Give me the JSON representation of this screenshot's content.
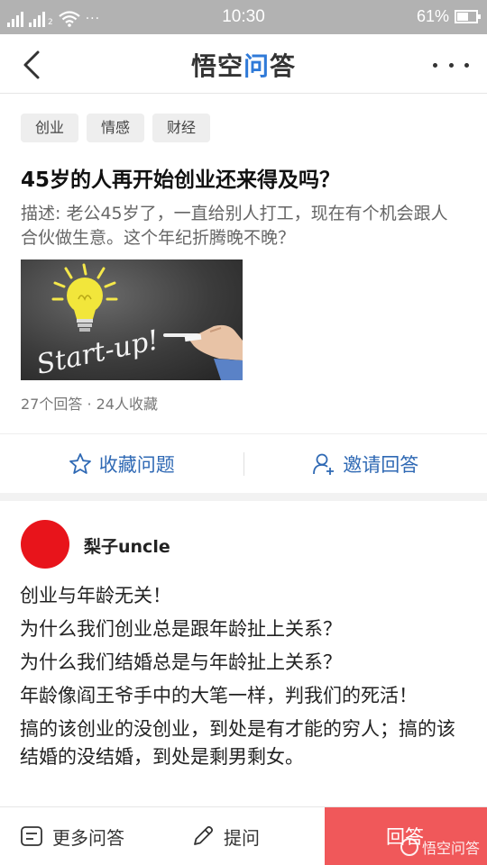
{
  "status_bar": {
    "time": "10:30",
    "battery_percent": "61%",
    "battery_level": 0.61,
    "sim_label": "2",
    "more_dots": "···"
  },
  "navbar": {
    "brand_part1": "悟空",
    "brand_part2": "问",
    "brand_part3": "答"
  },
  "question": {
    "tags": [
      "创业",
      "情感",
      "财经"
    ],
    "title": "45岁的人再开始创业还来得及吗？",
    "description": "描述: 老公45岁了，一直给别人打工，现在有个机会跟人合伙做生意。这个年纪折腾晚不晚？",
    "image_text": "Start-up!",
    "meta": "27个回答 · 24人收藏",
    "actions": {
      "favorite_label": "收藏问题",
      "invite_label": "邀请回答"
    }
  },
  "answer": {
    "author": "梨子uncle",
    "avatar_color": "#e8141b",
    "paragraphs": [
      "创业与年龄无关！",
      "为什么我们创业总是跟年龄扯上关系？",
      "为什么我们结婚总是与年龄扯上关系？",
      "年龄像阎王爷手中的大笔一样，判我们的死活！",
      "搞的该创业的没创业，到处是有才能的穷人；搞的该结婚的没结婚，到处是剩男剩女。"
    ]
  },
  "bottom_bar": {
    "more_answers_label": "更多问答",
    "ask_label": "提问",
    "answer_label": "回答",
    "watermark": "悟空问答"
  },
  "colors": {
    "accent_blue": "#2f69b4",
    "answer_button": "#f0585a",
    "status_bar": "#b2b2b2"
  }
}
